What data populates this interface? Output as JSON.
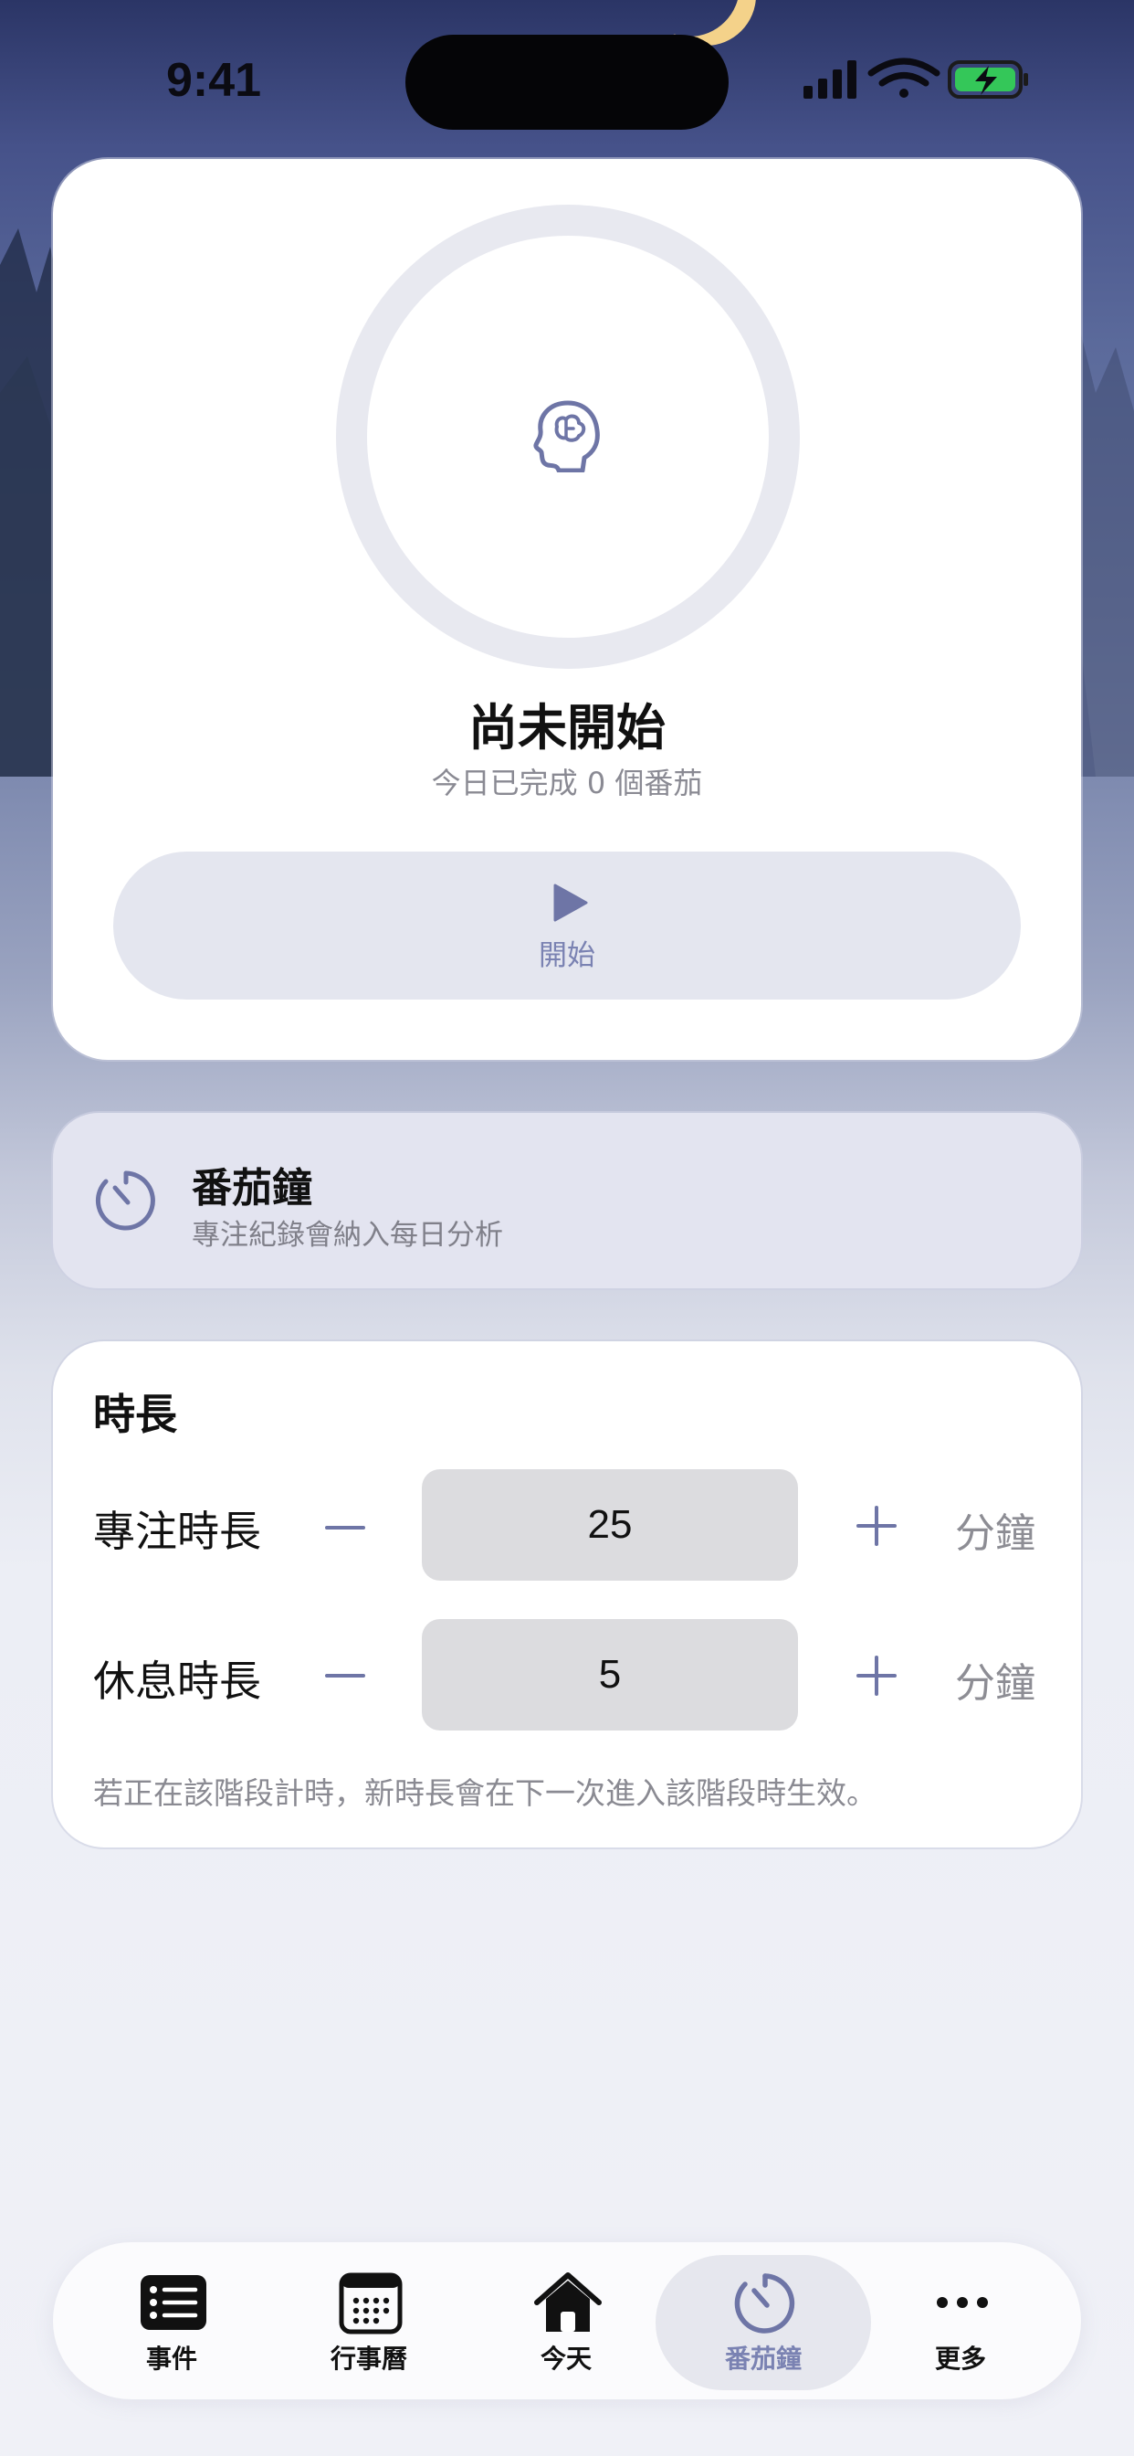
{
  "status_bar": {
    "time": "9:41"
  },
  "timer": {
    "state_title": "尚未開始",
    "done_text": "今日已完成 0 個番茄",
    "start_label": "開始"
  },
  "info": {
    "title": "番茄鐘",
    "subtitle": "專注紀錄會納入每日分析"
  },
  "durations": {
    "title": "時長",
    "rows": [
      {
        "label": "專注時長",
        "value": "25",
        "unit": "分鐘"
      },
      {
        "label": "休息時長",
        "value": "5",
        "unit": "分鐘"
      }
    ],
    "note": "若正在該階段計時，新時長會在下一次進入該階段時生效。"
  },
  "tabs": [
    {
      "label": "事件",
      "icon": "list-icon"
    },
    {
      "label": "行事曆",
      "icon": "calendar-icon"
    },
    {
      "label": "今天",
      "icon": "home-icon"
    },
    {
      "label": "番茄鐘",
      "icon": "timer-icon",
      "active": true
    },
    {
      "label": "更多",
      "icon": "more-icon"
    }
  ],
  "colors": {
    "accent": "#7a82b2",
    "active_tab_bg": "#e6e7ee"
  }
}
